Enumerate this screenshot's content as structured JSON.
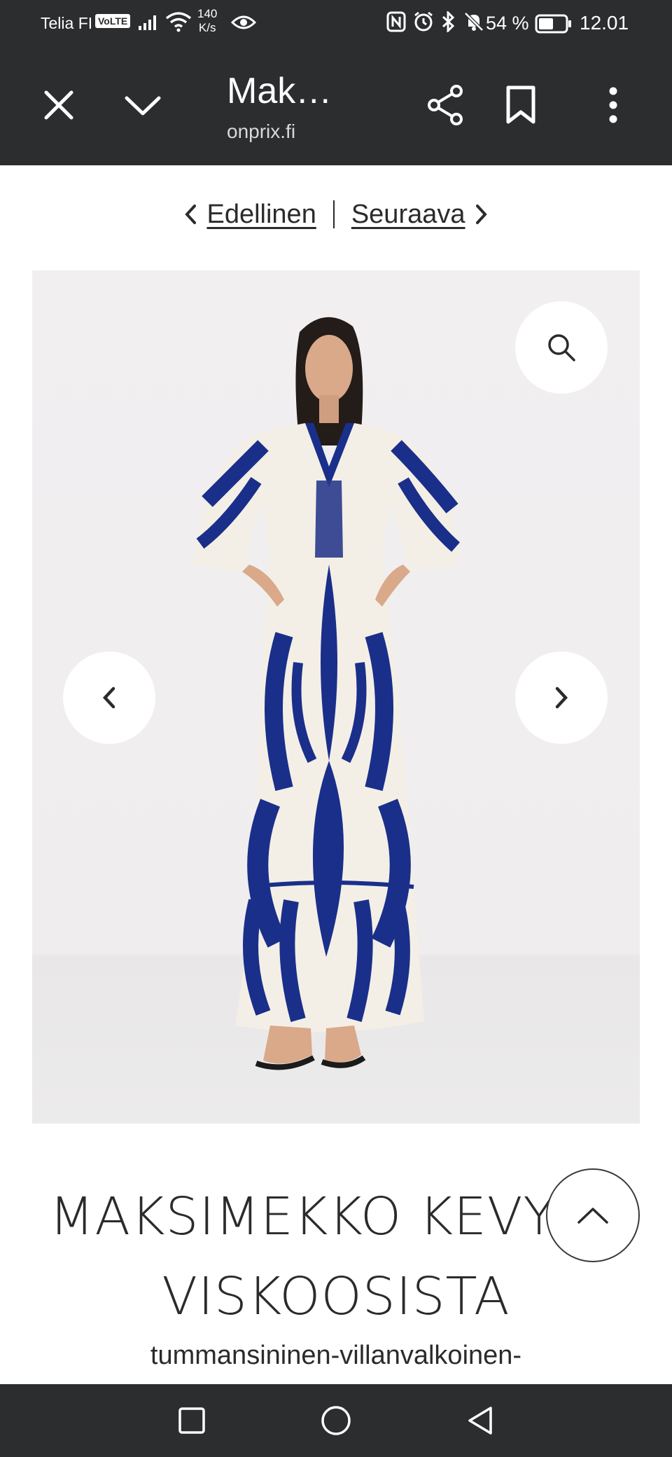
{
  "status_bar": {
    "carrier": "Telia FI",
    "volte": "VoLTE",
    "speed_value": "140",
    "speed_unit": "K/s",
    "battery_percent": "54 %",
    "time": "12.01"
  },
  "toolbar": {
    "title": "Mak…",
    "domain": "onprix.fi"
  },
  "pager": {
    "previous_label": "Edellinen",
    "next_label": "Seuraava"
  },
  "product": {
    "title_line1": "MAKSIMEKKO KEVYES",
    "title_line2": "VISKOOSISTA",
    "color": "tummansininen-villanvalkoinen-"
  },
  "colors": {
    "bar": "#2c2d2f",
    "dress_blue": "#1a2f8a",
    "dress_cream": "#f4efe6"
  }
}
